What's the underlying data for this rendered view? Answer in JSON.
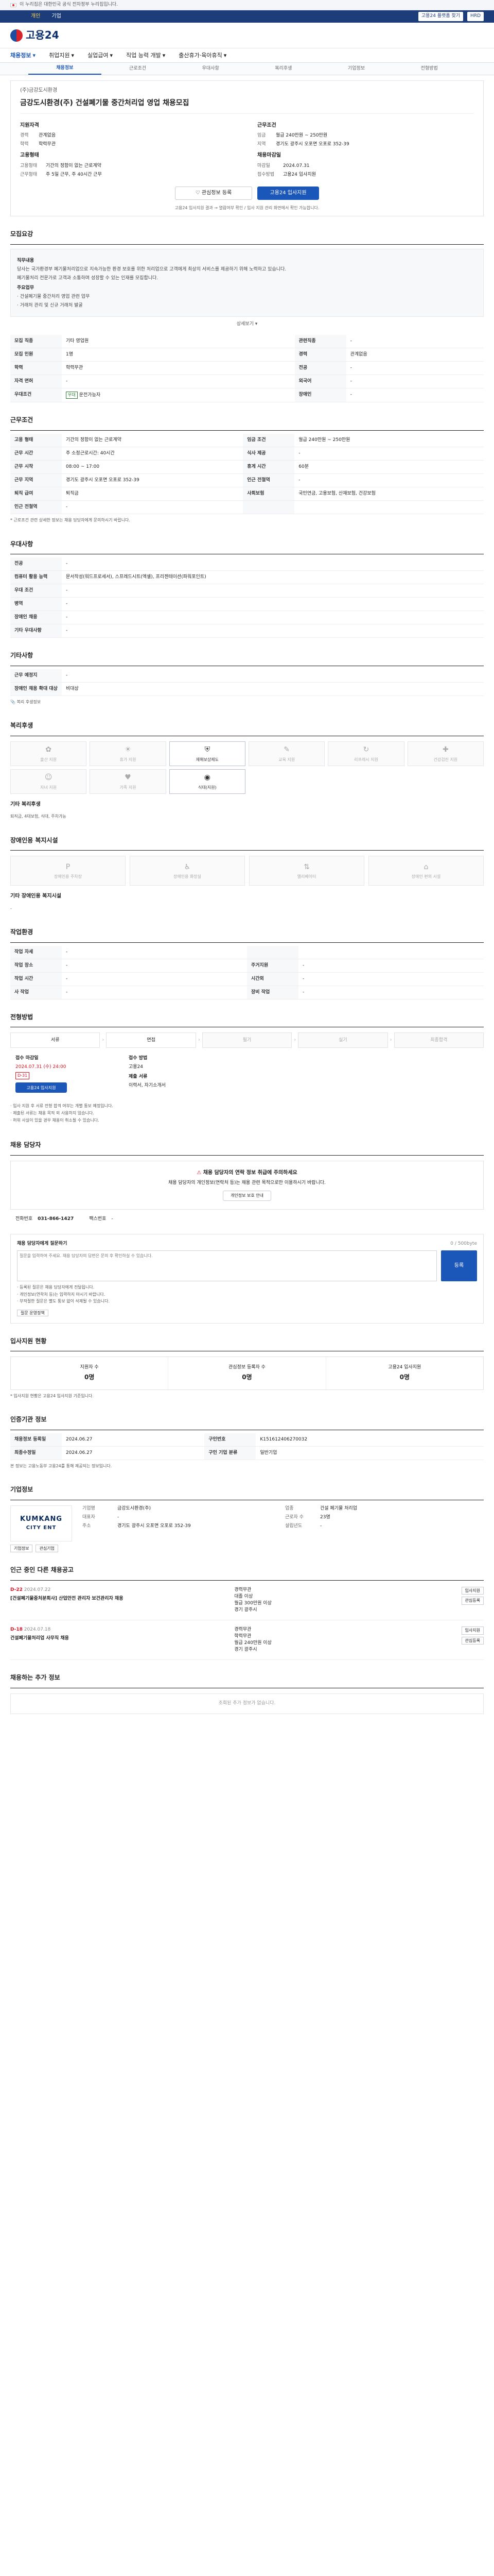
{
  "gov_bar": {
    "text": "이 누리집은 대한민국 공식 전자정부 누리집입니다."
  },
  "top_bar": {
    "items": [
      "개인",
      "기업"
    ],
    "right": [
      "고용24 플랫폼 찾기",
      "HRD",
      "국민내일배움카드"
    ]
  },
  "header": {
    "logo": "고용24"
  },
  "gnb": {
    "items": [
      "채용정보",
      "취업지원",
      "실업급여",
      "직업 능력 개발",
      "출산휴가·육아휴직"
    ]
  },
  "tabs": {
    "items": [
      "채용정보",
      "근로조건",
      "우대사항",
      "복리후생",
      "기업정보",
      "전형방법"
    ]
  },
  "job": {
    "company": "(주)금강도시환경",
    "title": "금강도시환경(주) 건설폐기물 중간처리업 영업 채용모집",
    "qualify_title": "지원자격",
    "qualify": [
      {
        "k": "경력",
        "v": "관계없음"
      },
      {
        "k": "학력",
        "v": "학력무관"
      }
    ],
    "condition_title": "근무조건",
    "condition": [
      {
        "k": "임금",
        "v": "월급 240만원 ~ 250만원"
      },
      {
        "k": "지역",
        "v": "경기도 광주시 오포면 오포로 352-39"
      }
    ],
    "type_title": "고용형태",
    "type": [
      {
        "k": "고용형태",
        "v": "기간의 정함이 없는 근로계약"
      },
      {
        "k": "근무형태",
        "v": "주 5일 근무, 주 40시간 근무"
      }
    ],
    "receipt_title": "채용마감일",
    "receipt": [
      {
        "k": "마감일",
        "v": "2024.07.31"
      },
      {
        "k": "접수방법",
        "v": "고용24 입사지원"
      }
    ],
    "btn_interest": "관심정보 등록",
    "btn_apply": "고용24 입사지원",
    "notice": "고용24 입사지원 결과 → 열람여부 확인 / 입사 지원 관리 화면에서 확인 가능합니다."
  },
  "recruit": {
    "section": "모집요강",
    "box_title": "직무내용",
    "box_lines": [
      "당사는 국가환경부 폐기물처리업으로 지속가능한 환경 보호를 위한 처리업으로 고객에게 최상의 서비스를 제공하기 위해 노력하고 있습니다.",
      "폐기물처리 전문가로 고객과 소통하며 성장할 수 있는 인재를 모집합니다."
    ],
    "box_sub": "주요업무",
    "box_sub_lines": [
      "· 건설폐기물 중간처리 영업 관련 업무",
      "· 거래처 관리 및 신규 거래처 발굴"
    ],
    "more": "상세보기",
    "rows": [
      {
        "k": "모집 직종",
        "v": "기타 영업원",
        "k2": "관련직종",
        "v2": "-"
      },
      {
        "k": "모집 인원",
        "v": "1명",
        "k2": "경력",
        "v2": "관계없음"
      },
      {
        "k": "학력",
        "v": "학력무관",
        "k2": "전공",
        "v2": "-"
      },
      {
        "k": "자격 면허",
        "v": "-",
        "k2": "외국어",
        "v2": "-"
      },
      {
        "k": "우대조건",
        "v": "운전가능자",
        "k2": "장애인",
        "v2": "-"
      }
    ]
  },
  "work": {
    "section": "근무조건",
    "rows": [
      {
        "k": "고용 형태",
        "v": "기간의 정함이 없는 근로계약",
        "k2": "임금 조건",
        "v2": "월급 240만원 ~ 250만원"
      },
      {
        "k": "근무 시간",
        "v": "주 소정근로시간: 40시간",
        "k2": "식사 제공",
        "v2": "-"
      },
      {
        "k": "근무 시작",
        "v": "08:00 ~ 17:00",
        "k2": "휴게 시간",
        "v2": "60분"
      },
      {
        "k": "근무 지역",
        "v": "경기도 광주시 오포면 오포로 352-39",
        "k2": "인근 전철역",
        "v2": "-"
      },
      {
        "k": "퇴직 급여",
        "v": "퇴직금",
        "k2": "사회보험",
        "v2": "국민연금, 고용보험, 산재보험, 건강보험"
      },
      {
        "k": "인근 전철역",
        "v": "-",
        "k2": "",
        "v2": ""
      }
    ],
    "note": "* 근로조건 관련 상세한 정보는 채용 담당자에게 문의하시기 바랍니다."
  },
  "prefer": {
    "section": "우대사항",
    "rows": [
      {
        "k": "전공",
        "v": "-"
      },
      {
        "k": "컴퓨터 활용 능력",
        "v": "문서작성(워드프로세서), 스프레드시트(엑셀), 프리젠테이션(파워포인트)"
      },
      {
        "k": "우대 조건",
        "v": "-"
      },
      {
        "k": "병역",
        "v": "-"
      },
      {
        "k": "장애인 채용",
        "v": "-"
      },
      {
        "k": "기타 우대사항",
        "v": "-"
      }
    ]
  },
  "etc": {
    "section": "기타사항",
    "rows": [
      {
        "k": "근무 예정지",
        "v": "-"
      },
      {
        "k": "장애인 채용 확대 대상",
        "v": "비대상"
      }
    ],
    "link": "복리 후생정보"
  },
  "welfare": {
    "section": "복리후생",
    "items": [
      {
        "label": "출산 지원",
        "on": false
      },
      {
        "label": "휴가 지원",
        "on": false
      },
      {
        "label": "재해보상제도",
        "on": true
      },
      {
        "label": "교육 지원",
        "on": false
      },
      {
        "label": "리프레시 지원",
        "on": false
      },
      {
        "label": "건강검진 지원",
        "on": false
      },
      {
        "label": "자녀 지원",
        "on": false
      },
      {
        "label": "가족 지원",
        "on": false
      },
      {
        "label": "식대(지원)",
        "on": true
      }
    ],
    "detail_title": "기타 복리후생",
    "detail": "퇴직금, 4대보험, 식대, 주차가능"
  },
  "disabled": {
    "section": "장애인용 복지시설",
    "items": [
      "장애인용 주차장",
      "장애인용 화장실",
      "엘리베이터",
      "장애인 편의 시설"
    ],
    "detail_title": "기타 장애인용 복지시설",
    "detail": "-"
  },
  "env": {
    "section": "작업환경",
    "rows": [
      {
        "k": "작업 자세",
        "v": "-",
        "k2": "",
        "v2": ""
      },
      {
        "k": "작업 장소",
        "v": "-",
        "k2": "주거지원",
        "v2": "-"
      },
      {
        "k": "작업 시간",
        "v": "-",
        "k2": "시간외",
        "v2": "-"
      },
      {
        "k": "사 작업",
        "v": "-",
        "k2": "장비 작업",
        "v2": "-"
      }
    ]
  },
  "process": {
    "section": "전형방법",
    "steps": [
      {
        "label": "서류",
        "on": true
      },
      {
        "label": "면접",
        "on": true
      },
      {
        "label": "필기",
        "on": false
      },
      {
        "label": "실기",
        "on": false
      },
      {
        "label": "최종합격",
        "on": false
      }
    ],
    "deadline_label": "접수 마감일",
    "deadline": "2024.07.31 (수) 24:00",
    "deadline_tag": "D-31",
    "apply_label": "접수 방법",
    "apply": "고용24",
    "doc_label": "제출 서류",
    "doc": "이력서, 자기소개서",
    "apply_btn": "고용24 입사지원",
    "notes": [
      "입사 지원 후 서류 전형 합격 여부는 개별 통보 예정입니다.",
      "제출된 서류는 채용 목적 외 사용하지 않습니다.",
      "허위 사실이 있을 경우 채용이 취소될 수 있습니다."
    ]
  },
  "manager": {
    "section": "채용 담당자",
    "warn": "채용 담당자의 연락 정보 취급에 주의하세요",
    "warn_desc": "채용 담당자의 개인정보(연락처 등)는 채용 관련 목적으로만 이용하시기 바랍니다.",
    "btn": "개인정보 보호 안내",
    "tel_label": "전화번호",
    "tel": "031-866-1427",
    "fax_label": "팩스번호",
    "fax": "-"
  },
  "ask": {
    "title": "채용 담당자에게 질문하기",
    "count": "0 / 500byte",
    "placeholder": "질문을 입력하여 주세요. 채용 담당자의 답변은 문의 후 확인하실 수 있습니다.",
    "send": "등록",
    "notes": [
      "등록된 질문은 채용 담당자에게 전달됩니다.",
      "개인정보(연락처 등)는 입력하지 마시기 바랍니다.",
      "부적절한 질문은 별도 통보 없이 삭제될 수 있습니다."
    ],
    "policy_btn": "질문 운영정책"
  },
  "applicants": {
    "section": "입사지원 현황",
    "items": [
      {
        "label": "지원자 수",
        "value": "0명"
      },
      {
        "label": "관심정보 등록자 수",
        "value": "0명"
      },
      {
        "label": "고용24 입사지원",
        "value": "0명"
      }
    ],
    "note": "* 입사지원 현황은 고용24 입사지원 기준입니다."
  },
  "info": {
    "section": "인증기관 정보",
    "rows": [
      {
        "k": "채용정보 등록일",
        "v": "2024.06.27",
        "k2": "구인번호",
        "v2": "K151612406270032"
      },
      {
        "k": "최종수정일",
        "v": "2024.06.27",
        "k2": "구인 기업 분류",
        "v2": "일반기업"
      }
    ],
    "note": "본 정보는 고용노동부 고용24를 통해 제공되는 정보입니다."
  },
  "company": {
    "section": "기업정보",
    "logo_main": "KUMKANG",
    "logo_sub": "CITY ENT",
    "rows": [
      {
        "k": "기업명",
        "v": "금강도시환경(주)"
      },
      {
        "k": "업종",
        "v": "건설 폐기물 처리업"
      },
      {
        "k": "대표자",
        "v": "-"
      },
      {
        "k": "근로자 수",
        "v": "23명"
      },
      {
        "k": "주소",
        "v": "경기도 광주시 오포면 오포로 352-39"
      },
      {
        "k": "설립년도",
        "v": "-"
      }
    ],
    "btn_info": "기업정보",
    "btn_more": "관심기업"
  },
  "related": {
    "section": "인근 중인 다른 채용공고",
    "items": [
      {
        "dday": "D-22",
        "date": "2024.07.22",
        "title": "[건설폐기물중처분회사] 산업안전 관리자 보건관리자 채용",
        "career": "경력무관",
        "edu": "대졸 이상",
        "pay": "월급 300만원 이상",
        "loc": "경기 광주시",
        "btn1": "입사지원",
        "btn2": "관심등록"
      },
      {
        "dday": "D-18",
        "date": "2024.07.18",
        "title": "건설폐기물처리업 사무직 채용",
        "career": "경력무관",
        "edu": "학력무관",
        "pay": "월급 240만원 이상",
        "loc": "경기 광주시",
        "btn1": "입사지원",
        "btn2": "관심등록"
      }
    ]
  },
  "cert": {
    "section": "채용하는 추가 정보",
    "empty": "조회된 추가 정보가 없습니다."
  }
}
